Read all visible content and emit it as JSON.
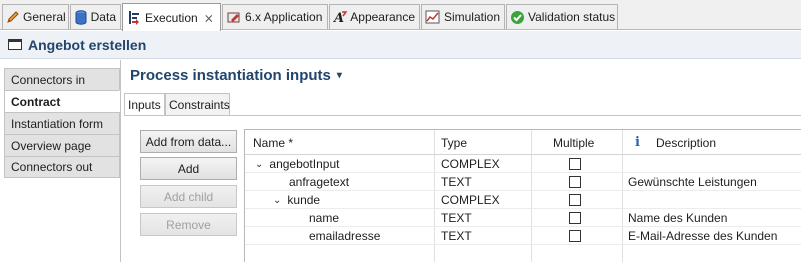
{
  "tabs": [
    {
      "label": "General",
      "icon": "pencil-icon"
    },
    {
      "label": "Data",
      "icon": "database-icon"
    },
    {
      "label": "Execution",
      "icon": "execution-icon",
      "active": true,
      "close": "⨯"
    },
    {
      "label": "6.x Application",
      "icon": "application-icon"
    },
    {
      "label": "Appearance",
      "icon": "appearance-icon"
    },
    {
      "label": "Simulation",
      "icon": "simulation-icon"
    },
    {
      "label": "Validation status",
      "icon": "validation-check-icon"
    }
  ],
  "title": "Angebot erstellen",
  "side_tabs": [
    {
      "label": "Connectors in"
    },
    {
      "label": "Contract",
      "active": true
    },
    {
      "label": "Instantiation form"
    },
    {
      "label": "Overview page"
    },
    {
      "label": "Connectors out"
    }
  ],
  "section": {
    "title": "Process instantiation inputs",
    "caret": "▾"
  },
  "inner_tabs": [
    {
      "label": "Inputs",
      "active": true
    },
    {
      "label": "Constraints"
    }
  ],
  "buttons": {
    "add_from_data": "Add from data...",
    "add": "Add",
    "add_child": "Add child",
    "remove": "Remove"
  },
  "table": {
    "headers": {
      "name": "Name *",
      "type": "Type",
      "multiple": "Multiple",
      "info": "i",
      "description": "Description"
    },
    "rows": [
      {
        "expander": "⌄",
        "name": "angebotInput",
        "type": "COMPLEX",
        "multiple": false,
        "description": ""
      },
      {
        "expander": "",
        "name": "anfragetext",
        "type": "TEXT",
        "multiple": false,
        "description": "Gewünschte Leistungen"
      },
      {
        "expander": "⌄",
        "name": "kunde",
        "type": "COMPLEX",
        "multiple": false,
        "description": ""
      },
      {
        "expander": "",
        "name": "name",
        "type": "TEXT",
        "multiple": false,
        "description": "Name des Kunden"
      },
      {
        "expander": "",
        "name": "emailadresse",
        "type": "TEXT",
        "multiple": false,
        "description": "E-Mail-Adresse des Kunden"
      }
    ]
  },
  "colors": {
    "accent": "#22456b",
    "validation": "#3aa53a",
    "info": "#2a62b3"
  }
}
